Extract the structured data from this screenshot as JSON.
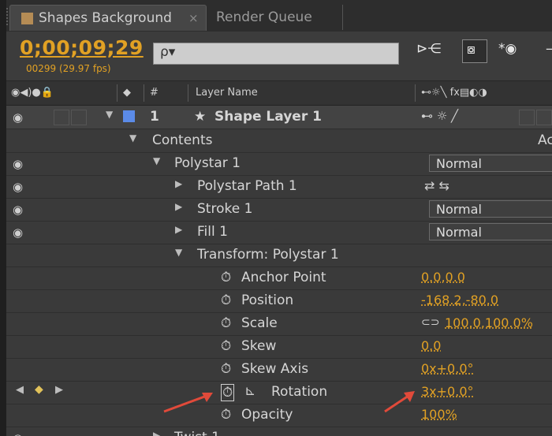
{
  "tabs": {
    "active_label": "Shapes Background",
    "active_close": "×",
    "render_label": "Render Queue"
  },
  "header": {
    "timecode": "0;00;09;29",
    "frame_info": "00299 (29.97 fps)",
    "search_glyph": "ρ▾"
  },
  "columns": {
    "layer_name": "Layer Name",
    "number": "#",
    "ad": "Ac"
  },
  "rows": [
    {
      "name": "1",
      "extra": "Shape Layer 1"
    },
    {
      "name": "Contents"
    },
    {
      "name": "Polystar 1",
      "mode": "Normal"
    },
    {
      "name": "Polystar Path 1"
    },
    {
      "name": "Stroke 1",
      "mode": "Normal"
    },
    {
      "name": "Fill 1",
      "mode": "Normal"
    },
    {
      "name": "Transform: Polystar 1"
    },
    {
      "name": "Anchor Point",
      "value": "0.0,0.0"
    },
    {
      "name": "Position",
      "value": "-168.2,-80.0"
    },
    {
      "name": "Scale",
      "value": "100.0,100.0%"
    },
    {
      "name": "Skew",
      "value": "0.0"
    },
    {
      "name": "Skew Axis",
      "value": "0x+0.0°"
    },
    {
      "name": "Rotation",
      "value": "3x+0.0°"
    },
    {
      "name": "Opacity",
      "value": "100%"
    },
    {
      "name": "Twist 1"
    }
  ],
  "colors": {
    "accent": "#e1a124",
    "label_blue": "#5b8be8",
    "arrow_red": "#e14a3a"
  }
}
